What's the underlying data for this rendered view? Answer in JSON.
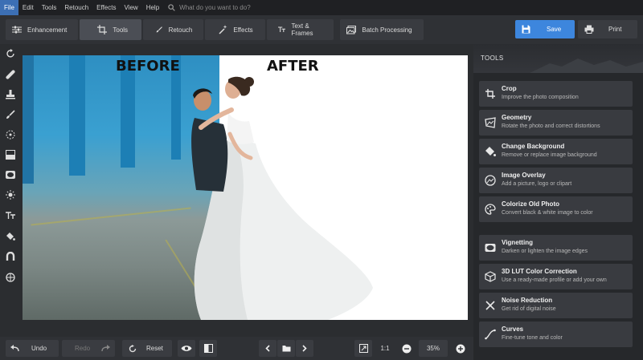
{
  "menu": {
    "items": [
      "File",
      "Edit",
      "Tools",
      "Retouch",
      "Effects",
      "View",
      "Help"
    ],
    "search_placeholder": "What do you want to do?"
  },
  "tabs": {
    "enhancement": "Enhancement",
    "tools": "Tools",
    "retouch": "Retouch",
    "effects": "Effects",
    "text_frames": "Text & Frames",
    "batch": "Batch Processing"
  },
  "actions": {
    "save": "Save",
    "print": "Print"
  },
  "canvas": {
    "before_label": "BEFORE",
    "after_label": "AFTER"
  },
  "panel": {
    "title": "TOOLS",
    "items": [
      {
        "title": "Crop",
        "desc": "Improve the photo composition",
        "icon": "crop-icon"
      },
      {
        "title": "Geometry",
        "desc": "Rotate the photo and correct distortions",
        "icon": "geometry-icon"
      },
      {
        "title": "Change Background",
        "desc": "Remove or replace image background",
        "icon": "bucket-icon"
      },
      {
        "title": "Image Overlay",
        "desc": "Add a picture, logo or clipart",
        "icon": "overlay-icon"
      },
      {
        "title": "Colorize Old Photo",
        "desc": "Convert black & white image to color",
        "icon": "palette-icon"
      },
      {
        "title": "Vignetting",
        "desc": "Darken or lighten the image edges",
        "icon": "vignette-icon"
      },
      {
        "title": "3D LUT Color Correction",
        "desc": "Use a ready-made profile or add your own",
        "icon": "cube-icon"
      },
      {
        "title": "Noise Reduction",
        "desc": "Get rid of digital noise",
        "icon": "noise-icon"
      },
      {
        "title": "Curves",
        "desc": "Fine-tune tone and color",
        "icon": "curves-icon"
      }
    ]
  },
  "bottom": {
    "undo": "Undo",
    "redo": "Redo",
    "reset": "Reset",
    "ratio": "1:1",
    "zoom": "35%"
  },
  "colors": {
    "accent": "#3d86dd",
    "panel_item": "#393b40",
    "background": "#2b2d30"
  }
}
